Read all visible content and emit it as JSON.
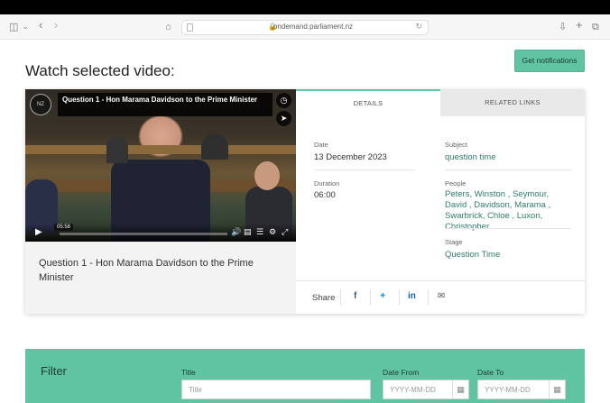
{
  "browser": {
    "url": "ondemand.parliament.nz"
  },
  "page": {
    "heading": "Watch selected video:",
    "notify_button": "Get notifications"
  },
  "video": {
    "overlay_title": "Question 1 - Hon Marama Davidson to the Prime Minister",
    "watermark": "NZ",
    "time_tooltip": "05:58",
    "caption": "Question 1 - Hon Marama Davidson to the Prime Minister",
    "progress": 0.0
  },
  "tabs": {
    "details": "DETAILS",
    "related": "RELATED LINKS"
  },
  "details": {
    "date_label": "Date",
    "date_value": "13 December 2023",
    "duration_label": "Duration",
    "duration_value": "06:00",
    "subject_label": "Subject",
    "subject_value": "question time",
    "people_label": "People",
    "people_value": "Peters, Winston , Seymour, David , Davidson, Marama , Swarbrick, Chloe , Luxon, Christopher",
    "stage_label": "Stage",
    "stage_value": "Question Time"
  },
  "share": {
    "label": "Share"
  },
  "filter": {
    "title": "Filter",
    "title_label": "Title",
    "title_placeholder": "Title",
    "date_from_label": "Date From",
    "date_from_placeholder": "YYYY-MM-DD",
    "date_to_label": "Date To",
    "date_to_placeholder": "YYYY-MM-DD"
  }
}
